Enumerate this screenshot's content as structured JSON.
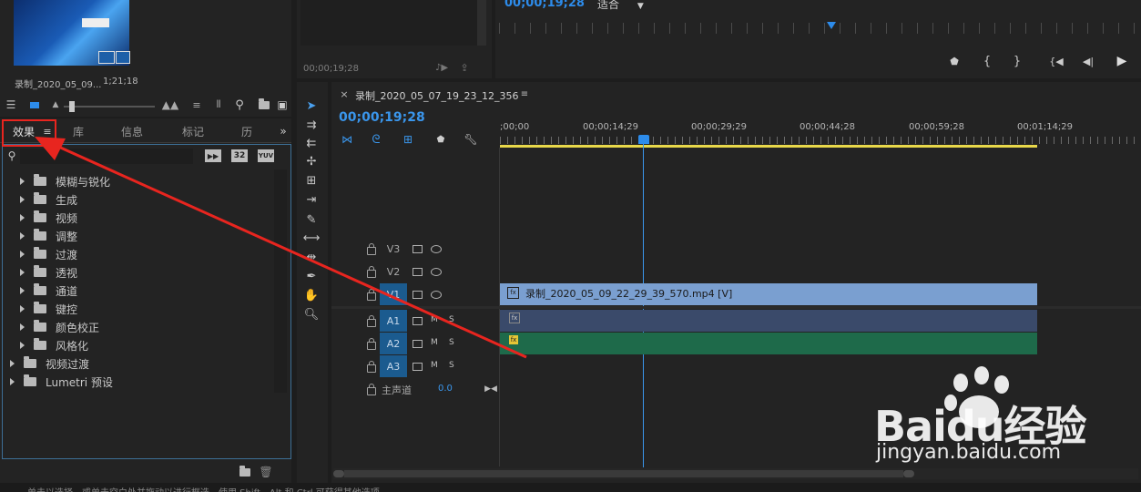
{
  "project": {
    "clip_name": "录制_2020_05_09...",
    "clip_duration": "1;21;18"
  },
  "source_monitor": {
    "timecode": "00;00;19;28"
  },
  "program_monitor": {
    "timecode": "00;00;19;28",
    "fit_label": "适合"
  },
  "effects_panel": {
    "tabs": [
      "效果",
      "库",
      "信息",
      "标记",
      "历"
    ],
    "badges": [
      "32",
      "YUV"
    ],
    "items": [
      {
        "label": "模糊与锐化",
        "level": 1
      },
      {
        "label": "生成",
        "level": 1
      },
      {
        "label": "视频",
        "level": 1
      },
      {
        "label": "调整",
        "level": 1
      },
      {
        "label": "过渡",
        "level": 1
      },
      {
        "label": "透视",
        "level": 1
      },
      {
        "label": "通道",
        "level": 1
      },
      {
        "label": "键控",
        "level": 1
      },
      {
        "label": "颜色校正",
        "level": 1
      },
      {
        "label": "风格化",
        "level": 1
      },
      {
        "label": "视频过渡",
        "level": 0
      },
      {
        "label": "Lumetri 预设",
        "level": 0
      }
    ]
  },
  "timeline": {
    "sequence_name": "录制_2020_05_07_19_23_12_356",
    "timecode": "00;00;19;28",
    "ruler_ticks": [
      ";00;00",
      "00;00;14;29",
      "00;00;29;29",
      "00;00;44;28",
      "00;00;59;28",
      "00;01;14;29"
    ],
    "tracks": {
      "video": [
        "V3",
        "V2",
        "V1"
      ],
      "audio": [
        "A1",
        "A2",
        "A3"
      ],
      "master_label": "主声道",
      "master_value": "0.0"
    },
    "v1_clip_label": "录制_2020_05_09_22_29_39_570.mp4 [V]",
    "fx_badge": "fx",
    "m_label": "M",
    "s_label": "S"
  },
  "status_bar": {
    "text": "单击以选择，或单击空白处并拖动以进行框选。使用 Shift、Alt 和 Ctrl 可获得其他选项。"
  },
  "watermark": {
    "brand": "Baidu经验",
    "url": "jingyan.baidu.com"
  },
  "colors": {
    "accent_blue": "#2d8ceb",
    "video_clip": "#7a9fd0",
    "audio_a1": "#3a4a6a",
    "audio_a2": "#1e6a4a",
    "annotation_red": "#e8251f"
  }
}
